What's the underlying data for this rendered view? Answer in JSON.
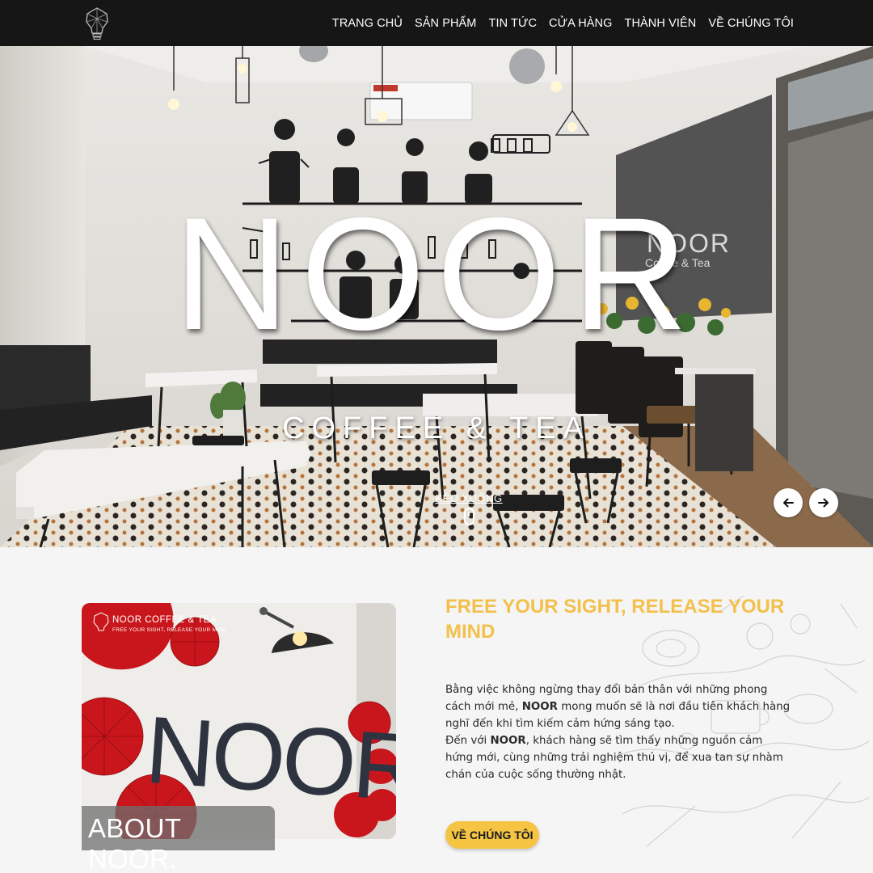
{
  "header": {
    "logo_icon": "lightbulb-logo-icon",
    "nav": [
      {
        "label": "TRANG CHỦ"
      },
      {
        "label": "SẢN PHẨM"
      },
      {
        "label": "TIN TỨC"
      },
      {
        "label": "CỬA HÀNG"
      },
      {
        "label": "THÀNH VIÊN"
      },
      {
        "label": "VỀ CHÚNG TÔI"
      }
    ],
    "background": "#161616"
  },
  "hero": {
    "title": "NOOR",
    "subtitle": "COFFEE & TEA",
    "scroll_label": "KÉO XUỐNG",
    "window_sign_title": "NOOR",
    "window_sign_sub": "Coffee & Tea",
    "prev_icon": "arrow-left-icon",
    "next_icon": "arrow-right-icon"
  },
  "about": {
    "photo_brand": "NOOR COFFEE & TEA",
    "photo_tagline": "FREE YOUR SIGHT, RELEASE YOUR MIND",
    "photo_wall_text": "NOOR",
    "caption": "ABOUT NOOR.",
    "heading": "FREE YOUR SIGHT, RELEASE YOUR MIND",
    "paragraph1_before": "Bằng việc không ngừng thay đổi bản thân với những phong cách mới mẻ, ",
    "paragraph1_brand": "NOOR",
    "paragraph1_after": " mong muốn sẽ là nơi đầu tiên khách hàng nghĩ đến khi tìm kiếm cảm hứng sáng tạo.",
    "paragraph2_before": "Đến với ",
    "paragraph2_brand": "NOOR",
    "paragraph2_after": ", khách hàng sẽ tìm thấy những nguồn cảm hứng mới, cùng những trải nghiệm thú vị, để xua tan sự nhàm chán của cuộc sống thường nhật.",
    "cta_label": "VỀ CHÚNG TÔI",
    "accent_color": "#f3c04c",
    "button_color": "#f5c443"
  }
}
